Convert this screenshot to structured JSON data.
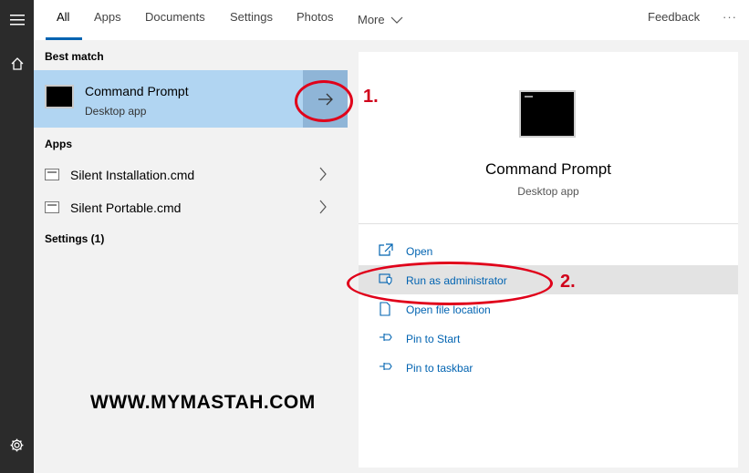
{
  "tabs": [
    {
      "label": "All",
      "active": true
    },
    {
      "label": "Apps"
    },
    {
      "label": "Documents"
    },
    {
      "label": "Settings"
    },
    {
      "label": "Photos"
    },
    {
      "label": "More"
    }
  ],
  "header": {
    "feedback": "Feedback",
    "overflow": "···"
  },
  "left": {
    "best_match_heading": "Best match",
    "best_match": {
      "title": "Command Prompt",
      "subtitle": "Desktop app"
    },
    "apps_heading": "Apps",
    "apps": [
      {
        "label": "Silent Installation.cmd"
      },
      {
        "label": "Silent Portable.cmd"
      }
    ],
    "settings_heading": "Settings (1)"
  },
  "right": {
    "title": "Command Prompt",
    "subtitle": "Desktop app",
    "actions": [
      {
        "label": "Open",
        "icon": "open-icon"
      },
      {
        "label": "Run as administrator",
        "icon": "shield-icon"
      },
      {
        "label": "Open file location",
        "icon": "file-location-icon"
      },
      {
        "label": "Pin to Start",
        "icon": "pin-icon"
      },
      {
        "label": "Pin to taskbar",
        "icon": "pin-icon"
      }
    ]
  },
  "annotations": {
    "step1": "1.",
    "step2": "2.",
    "watermark": "WWW.MYMASTAH.COM"
  },
  "colors": {
    "accent": "#0063b1",
    "selection": "#b1d5f2",
    "annotation": "#e0001a",
    "rail": "#2b2b2b"
  }
}
